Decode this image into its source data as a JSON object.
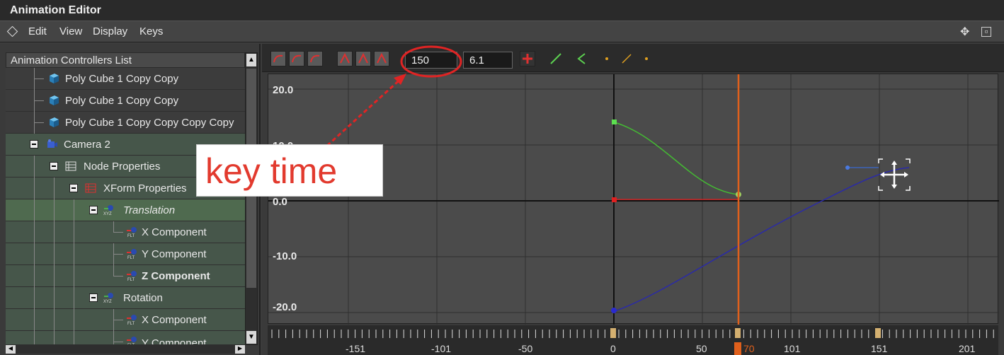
{
  "window": {
    "title": "Animation Editor"
  },
  "menu": {
    "items": [
      "Edit",
      "View",
      "Display",
      "Keys"
    ]
  },
  "controllers": {
    "header": "Animation Controllers List",
    "rows": [
      {
        "label": "Poly Cube 1 Copy Copy"
      },
      {
        "label": "Poly Cube 1 Copy Copy"
      },
      {
        "label": "Poly Cube 1 Copy Copy Copy Copy"
      },
      {
        "label": "Camera 2"
      },
      {
        "label": "Node Properties"
      },
      {
        "label": "XForm Properties"
      },
      {
        "label": "Translation"
      },
      {
        "label": "X Component"
      },
      {
        "label": "Y Component"
      },
      {
        "label": "Z Component"
      },
      {
        "label": "Rotation"
      },
      {
        "label": "X Component"
      },
      {
        "label": "Y Component"
      }
    ]
  },
  "toolbar": {
    "key_time": "150",
    "key_value": "6.1"
  },
  "annotation": {
    "text": "key time"
  },
  "graph": {
    "y_labels": [
      "20.0",
      "10.0",
      "0.0",
      "-10.0",
      "-20.0"
    ],
    "x_labels": [
      "-151",
      "-101",
      "-50",
      "0",
      "50",
      "70",
      "101",
      "151",
      "201"
    ],
    "current_frame": "70",
    "colors": {
      "x_curve": "#cc2222",
      "y_curve": "#44bb33",
      "z_curve": "#2a2aa8",
      "time_cursor": "#e0601c"
    }
  },
  "icons": {
    "move": "move-icon",
    "maximize": "maximize-icon",
    "graph_options": "diamond-icon"
  }
}
